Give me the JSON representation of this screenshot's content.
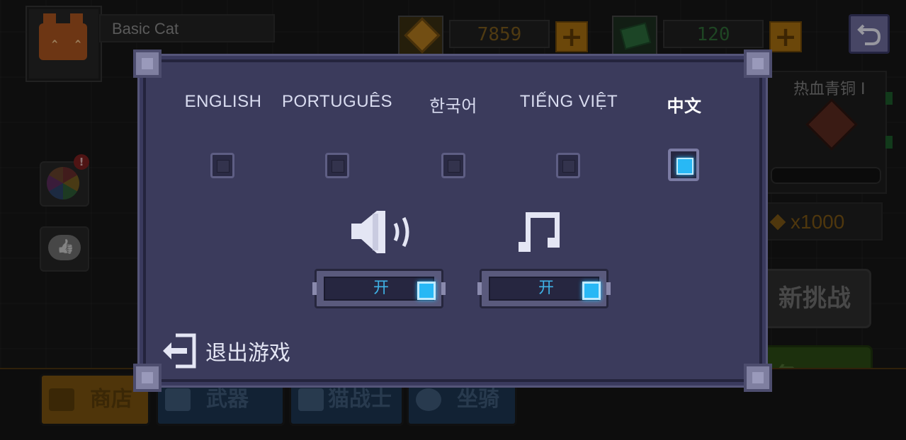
{
  "player": {
    "name": "Basic Cat"
  },
  "resources": {
    "gold": {
      "value": "7859",
      "icon": "gold-gem-icon"
    },
    "cash": {
      "value": "120",
      "icon": "cash-icon"
    }
  },
  "background_panel": {
    "rank_title": "热血青铜 I",
    "reward_text": "x1000",
    "challenge_label": "新挑战",
    "task_label": "务"
  },
  "bottom_nav": {
    "items": [
      {
        "label": "商店",
        "icon": "cart-icon"
      },
      {
        "label": "武器",
        "icon": "weapon-icon"
      },
      {
        "label": "猫战士",
        "icon": "cat-warrior-icon"
      },
      {
        "label": "坐骑",
        "icon": "mount-icon"
      }
    ]
  },
  "alerts": {
    "wheel_badge": "!"
  },
  "settings": {
    "languages": [
      {
        "label": "ENGLISH",
        "selected": false
      },
      {
        "label": "PORTUGUÊS",
        "selected": false
      },
      {
        "label": "한국어",
        "selected": false
      },
      {
        "label": "TIẾNG VIỆT",
        "selected": false
      },
      {
        "label": "中文",
        "selected": true
      }
    ],
    "sound": {
      "icon": "speaker-icon",
      "state_label": "开",
      "on": true
    },
    "music": {
      "icon": "music-note-icon",
      "state_label": "开",
      "on": true
    },
    "exit": {
      "label": "退出游戏",
      "icon": "exit-door-icon"
    }
  },
  "colors": {
    "modal_bg": "#3b3b5c",
    "modal_border": "#555579",
    "accent_blue": "#28b8f5",
    "text_light": "#d9dcf0"
  }
}
